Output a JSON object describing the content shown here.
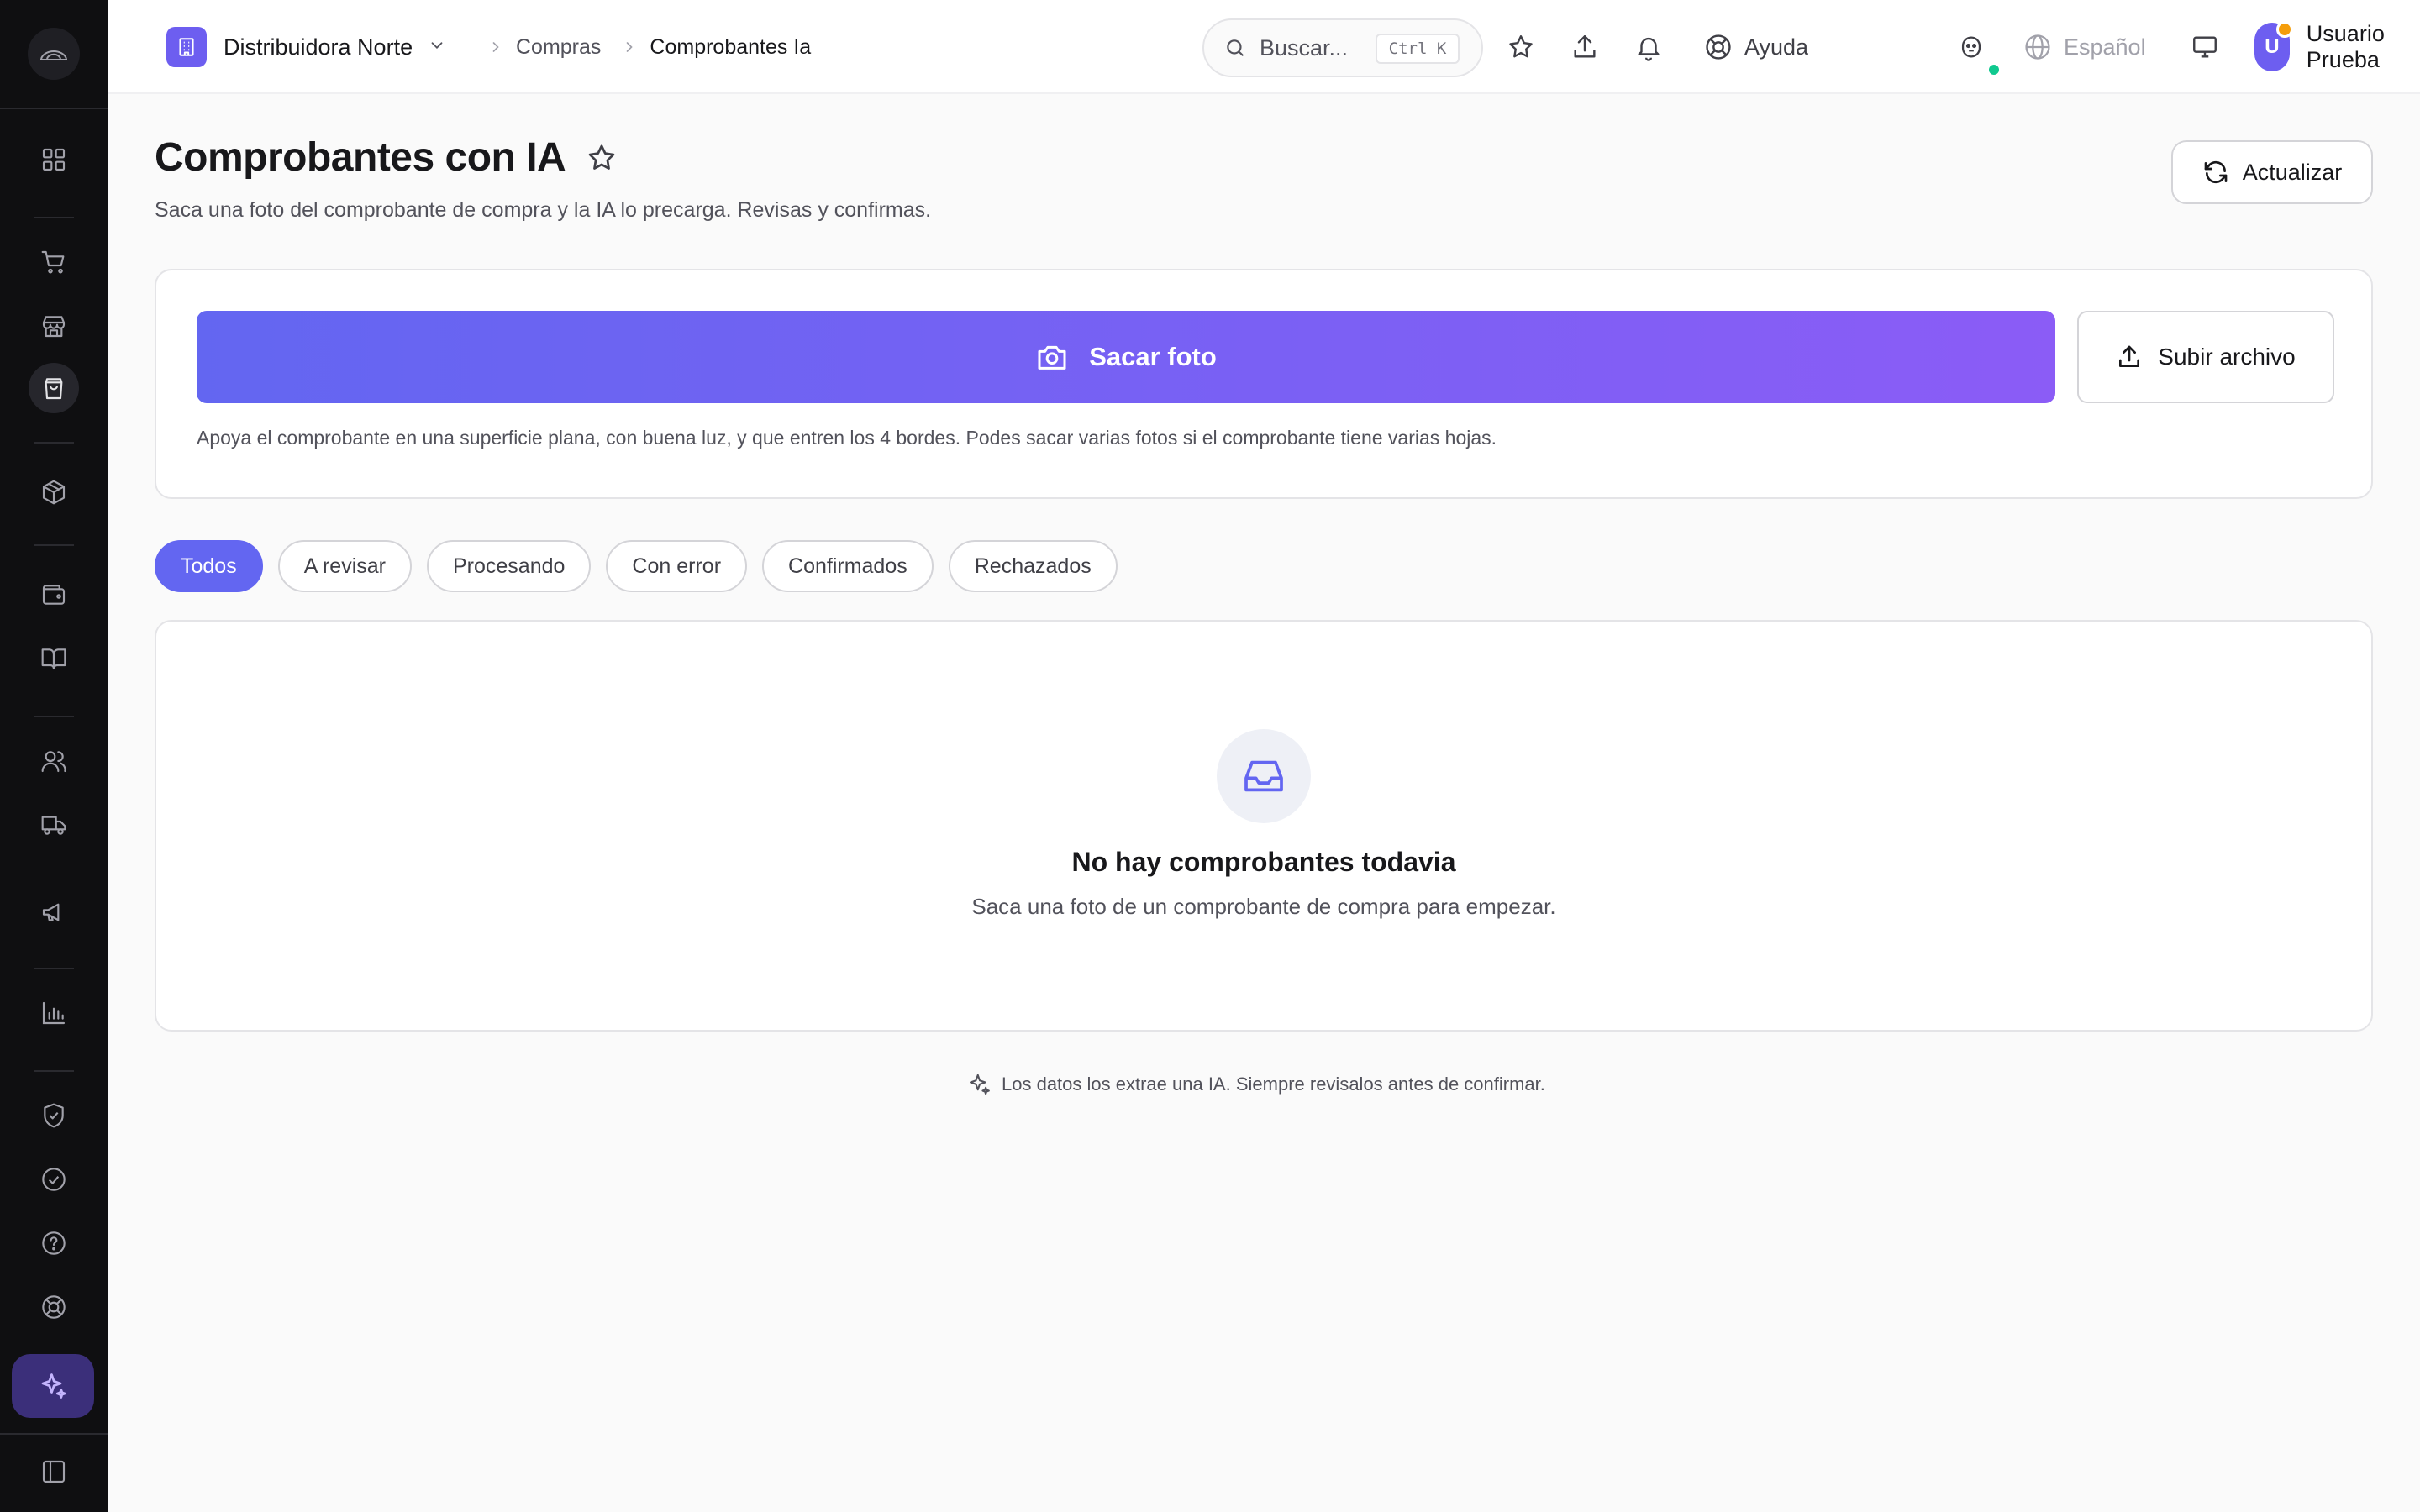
{
  "sidebar": {
    "logo": "dome-logo-icon",
    "items": [
      {
        "icon": "dashboard-grid-icon",
        "active": false
      },
      {
        "icon": "cart-icon",
        "active": false
      },
      {
        "icon": "store-icon",
        "active": false
      },
      {
        "icon": "shopping-bag-icon",
        "active": true
      },
      {
        "icon": "package-icon",
        "active": false
      },
      {
        "icon": "wallet-icon",
        "active": false
      },
      {
        "icon": "book-icon",
        "active": false
      },
      {
        "icon": "users-icon",
        "active": false
      },
      {
        "icon": "truck-icon",
        "active": false
      },
      {
        "icon": "megaphone-icon",
        "active": false
      },
      {
        "icon": "bar-chart-icon",
        "active": false
      },
      {
        "icon": "shield-check-icon",
        "active": false
      },
      {
        "icon": "check-circle-icon",
        "active": false
      },
      {
        "icon": "help-circle-icon",
        "active": false
      },
      {
        "icon": "lifebuoy-icon",
        "active": false
      },
      {
        "icon": "sparkles-icon",
        "active": true
      },
      {
        "icon": "panel-toggle-icon",
        "active": false
      }
    ]
  },
  "topbar": {
    "org_name": "Distribuidora Norte",
    "breadcrumb": [
      "Compras",
      "Comprobantes Ia"
    ],
    "search": {
      "placeholder": "Buscar...",
      "shortcut": "Ctrl K"
    },
    "help_label": "Ayuda",
    "language": "Español",
    "user": {
      "initial": "U",
      "name": "Usuario Prueba"
    }
  },
  "page": {
    "title": "Comprobantes con IA",
    "subtitle": "Saca una foto del comprobante de compra y la IA lo precarga. Revisas y confirmas.",
    "refresh_label": "Actualizar"
  },
  "upload": {
    "photo_label": "Sacar foto",
    "file_label": "Subir archivo",
    "hint": "Apoya el comprobante en una superficie plana, con buena luz, y que entren los 4 bordes. Podes sacar varias fotos si el comprobante tiene varias hojas."
  },
  "filters": [
    {
      "label": "Todos",
      "active": true
    },
    {
      "label": "A revisar",
      "active": false
    },
    {
      "label": "Procesando",
      "active": false
    },
    {
      "label": "Con error",
      "active": false
    },
    {
      "label": "Confirmados",
      "active": false
    },
    {
      "label": "Rechazados",
      "active": false
    }
  ],
  "empty_state": {
    "title": "No hay comprobantes todavia",
    "description": "Saca una foto de un comprobante de compra para empezar."
  },
  "disclaimer": "Los datos los extrae una IA. Siempre revisalos antes de confirmar.",
  "colors": {
    "accent": "#6366f1",
    "accent_end": "#8b5cf6",
    "sidebar_bg": "#0f0f11",
    "status_online": "#10c98f",
    "notification": "#f59e0b"
  }
}
